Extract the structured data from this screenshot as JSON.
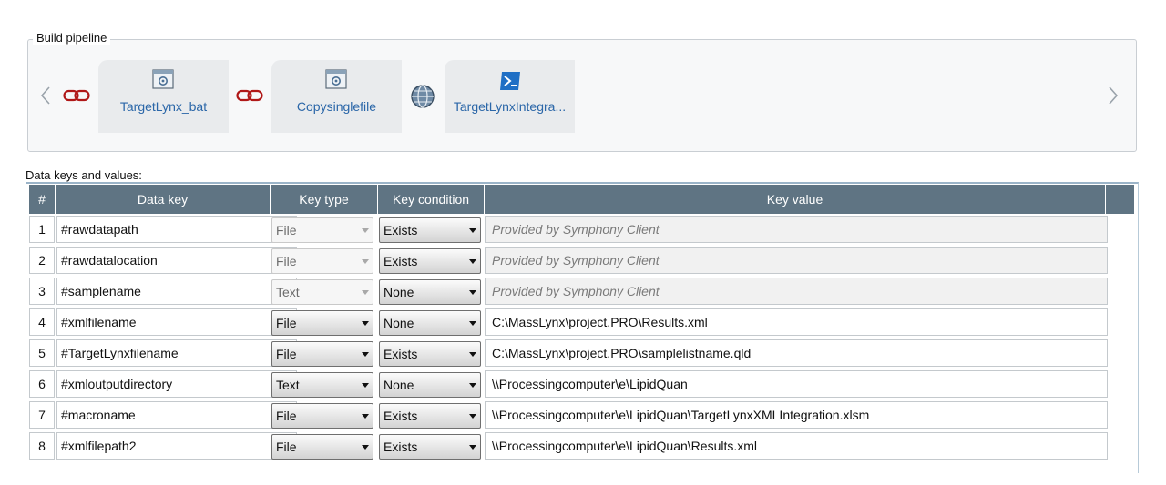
{
  "pipeline": {
    "legend": "Build pipeline",
    "steps": [
      {
        "label": "TargetLynx_bat",
        "icon": "script-gear-icon"
      },
      {
        "label": "Copysinglefile",
        "icon": "script-gear-icon"
      },
      {
        "label": "TargetLynxIntegra...",
        "icon": "powershell-icon"
      }
    ],
    "connectors": [
      "chain-link-icon",
      "chain-link-icon",
      "globe-icon"
    ]
  },
  "data_keys": {
    "label": "Data keys and values:",
    "columns": [
      "#",
      "Data key",
      "Key type",
      "Key condition",
      "Key value"
    ],
    "rows": [
      {
        "num": "1",
        "key": "#rawdatapath",
        "type": "File",
        "condition": "Exists",
        "value": "Provided by Symphony Client",
        "type_disabled": true,
        "value_placeholder": true
      },
      {
        "num": "2",
        "key": "#rawdatalocation",
        "type": "File",
        "condition": "Exists",
        "value": "Provided by Symphony Client",
        "type_disabled": true,
        "value_placeholder": true
      },
      {
        "num": "3",
        "key": "#samplename",
        "type": "Text",
        "condition": "None",
        "value": "Provided by Symphony Client",
        "type_disabled": true,
        "value_placeholder": true
      },
      {
        "num": "4",
        "key": "#xmlfilename",
        "type": "File",
        "condition": "None",
        "value": "C:\\MassLynx\\project.PRO\\Results.xml",
        "type_disabled": false,
        "value_placeholder": false
      },
      {
        "num": "5",
        "key": "#TargetLynxfilename",
        "type": "File",
        "condition": "Exists",
        "value": "C:\\MassLynx\\project.PRO\\samplelistname.qld",
        "type_disabled": false,
        "value_placeholder": false
      },
      {
        "num": "6",
        "key": "#xmloutputdirectory",
        "type": "Text",
        "condition": "None",
        "value": "\\\\Processingcomputer\\e\\LipidQuan",
        "type_disabled": false,
        "value_placeholder": false
      },
      {
        "num": "7",
        "key": "#macroname",
        "type": "File",
        "condition": "Exists",
        "value": "\\\\Processingcomputer\\e\\LipidQuan\\TargetLynxXMLIntegration.xlsm",
        "type_disabled": false,
        "value_placeholder": false
      },
      {
        "num": "8",
        "key": "#xmlfilepath2",
        "type": "File",
        "condition": "Exists",
        "value": "\\\\Processingcomputer\\e\\LipidQuan\\Results.xml",
        "type_disabled": false,
        "value_placeholder": false
      }
    ]
  },
  "colors": {
    "header_bg": "#5f7483",
    "link_text": "#2a66a8",
    "chain_red": "#b01818"
  }
}
